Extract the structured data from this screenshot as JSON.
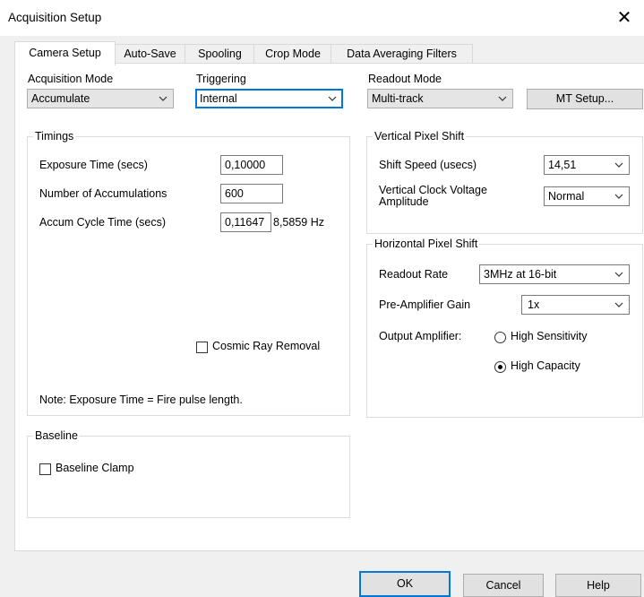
{
  "window": {
    "title": "Acquisition Setup",
    "close_glyph": "✕"
  },
  "tabs": [
    {
      "label": "Camera Setup",
      "active": true
    },
    {
      "label": "Auto-Save"
    },
    {
      "label": "Spooling"
    },
    {
      "label": "Crop Mode"
    },
    {
      "label": "Data Averaging Filters"
    }
  ],
  "acquisition_mode": {
    "label": "Acquisition Mode",
    "value": "Accumulate"
  },
  "triggering": {
    "label": "Triggering",
    "value": "Internal"
  },
  "readout_mode": {
    "label": "Readout Mode",
    "value": "Multi-track",
    "setup_button": "MT Setup..."
  },
  "timings": {
    "title": "Timings",
    "exposure_label": "Exposure Time (secs)",
    "exposure_value": "0,10000",
    "accumulations_label": "Number of Accumulations",
    "accumulations_value": "600",
    "cycle_label": "Accum Cycle Time (secs)",
    "cycle_value": "0,11647",
    "frequency": "8,5859 Hz",
    "cosmic_ray_label": "Cosmic Ray Removal",
    "note": "Note: Exposure Time = Fire pulse length."
  },
  "vertical_shift": {
    "title": "Vertical Pixel Shift",
    "speed_label": "Shift Speed (usecs)",
    "speed_value": "14,51",
    "voltage_label_line1": "Vertical Clock Voltage",
    "voltage_label_line2": "Amplitude",
    "voltage_value": "Normal"
  },
  "horizontal_shift": {
    "title": "Horizontal Pixel Shift",
    "rate_label": "Readout Rate",
    "rate_value": "3MHz at 16-bit",
    "gain_label": "Pre-Amplifier Gain",
    "gain_value": "1x",
    "amplifier_label": "Output Amplifier:",
    "opt_sensitivity": "High Sensitivity",
    "opt_capacity": "High Capacity",
    "selected": "High Capacity"
  },
  "baseline": {
    "title": "Baseline",
    "clamp_label": "Baseline Clamp"
  },
  "buttons": {
    "ok": "OK",
    "cancel": "Cancel",
    "help": "Help"
  },
  "icons": {
    "dropdown": "chevron-down-icon",
    "close": "close-icon"
  }
}
